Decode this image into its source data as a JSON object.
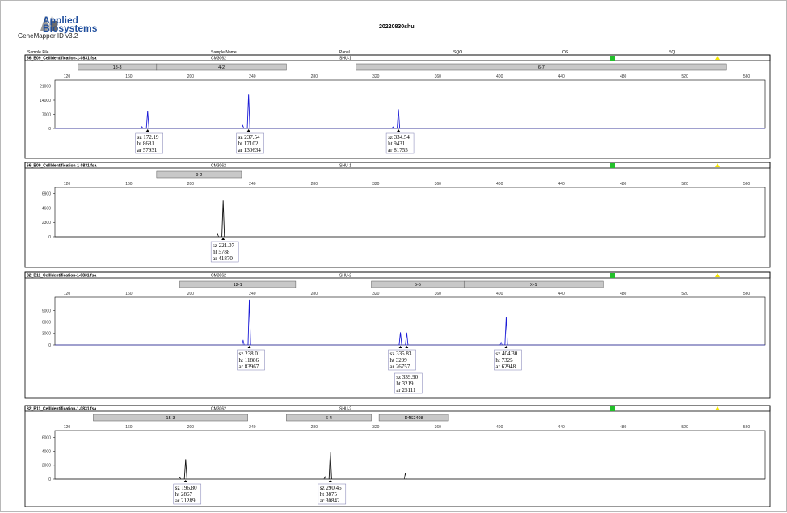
{
  "header": {
    "logo_line1": "Applied",
    "logo_line2": "Biosystems",
    "software": "GeneMapper ID v3.2",
    "title": "20220830shu"
  },
  "columns": {
    "sample_file": "Sample File",
    "sample_name": "Sample Name",
    "panel": "Panel",
    "sqo": "SQO",
    "os": "OS",
    "sq": "SQ"
  },
  "colors": {
    "blue": "#1a1ad6",
    "black": "#111111",
    "bin": "#c8c8c8",
    "green": "#22c02a",
    "yellow": "#f5e600"
  },
  "chart_data": [
    {
      "type": "line",
      "sample_file": "66_B09_CellIdentification-1-0831.fsa",
      "sample_name": "CM3062",
      "panel": "SHU-1",
      "color": "blue",
      "x_ticks": [
        120,
        160,
        200,
        240,
        280,
        320,
        360,
        400,
        440,
        480,
        520,
        560
      ],
      "y_ticks": [
        0,
        7000,
        14000,
        21000
      ],
      "xlim": [
        97,
        572
      ],
      "ylim": [
        0,
        24000
      ],
      "markers": [
        {
          "label": "18-3",
          "start": 127,
          "end": 178
        },
        {
          "label": "4-2",
          "start": 178,
          "end": 262
        },
        {
          "label": "6-7",
          "start": 307,
          "end": 547
        }
      ],
      "peaks": [
        {
          "x": 172.19,
          "height": 8681,
          "sz": "172.19",
          "ht": "8681",
          "ar": "57931"
        },
        {
          "x": 237.54,
          "height": 17102,
          "sz": "237.54",
          "ht": "17102",
          "ar": "130634"
        },
        {
          "x": 334.54,
          "height": 9431,
          "sz": "334.54",
          "ht": "9431",
          "ar": "81755"
        }
      ],
      "minor_peaks": [
        {
          "x": 168.5,
          "height": 900
        },
        {
          "x": 233.8,
          "height": 1500
        },
        {
          "x": 331,
          "height": 800
        }
      ]
    },
    {
      "type": "line",
      "sample_file": "66_B09_CellIdentification-1-0831.fsa",
      "sample_name": "CM3062",
      "panel": "SHU-1",
      "color": "black",
      "x_ticks": [
        120,
        160,
        200,
        240,
        280,
        320,
        360,
        400,
        440,
        480,
        520,
        560
      ],
      "y_ticks": [
        0,
        2300,
        4600,
        6900
      ],
      "xlim": [
        97,
        572
      ],
      "ylim": [
        0,
        7900
      ],
      "markers": [
        {
          "label": "9-2",
          "start": 178,
          "end": 233
        }
      ],
      "peaks": [
        {
          "x": 221.07,
          "height": 5788,
          "sz": "221.07",
          "ht": "5788",
          "ar": "41870"
        }
      ],
      "minor_peaks": [
        {
          "x": 217.5,
          "height": 400
        }
      ]
    },
    {
      "type": "line",
      "sample_file": "82_B11_CellIdentification-1-0831.fsa",
      "sample_name": "CM3062",
      "panel": "SHU-2",
      "color": "blue",
      "x_ticks": [
        120,
        160,
        200,
        240,
        280,
        320,
        360,
        400,
        440,
        480,
        520,
        560
      ],
      "y_ticks": [
        0,
        3000,
        6000,
        9000
      ],
      "xlim": [
        97,
        572
      ],
      "ylim": [
        0,
        12500
      ],
      "markers": [
        {
          "label": "12-1",
          "start": 193,
          "end": 268
        },
        {
          "label": "5-5",
          "start": 317,
          "end": 377
        },
        {
          "label": "X-1",
          "start": 377,
          "end": 467
        }
      ],
      "peaks": [
        {
          "x": 238.01,
          "height": 11886,
          "sz": "238.01",
          "ht": "11886",
          "ar": "83967"
        },
        {
          "x": 335.83,
          "height": 3299,
          "sz": "335.83",
          "ht": "3299",
          "ar": "26757"
        },
        {
          "x": 339.9,
          "height": 3219,
          "sz": "339.90",
          "ht": "3219",
          "ar": "25111"
        },
        {
          "x": 404.3,
          "height": 7325,
          "sz": "404.30",
          "ht": "7325",
          "ar": "62948"
        }
      ],
      "minor_peaks": [
        {
          "x": 234,
          "height": 1300
        },
        {
          "x": 401,
          "height": 700
        }
      ]
    },
    {
      "type": "line",
      "sample_file": "82_B11_CellIdentification-1-0831.fsa",
      "sample_name": "CM3062",
      "panel": "SHU-2",
      "color": "black",
      "x_ticks": [
        120,
        160,
        200,
        240,
        280,
        320,
        360,
        400,
        440,
        480,
        520,
        560
      ],
      "y_ticks": [
        0,
        2000,
        4000,
        6000
      ],
      "xlim": [
        97,
        572
      ],
      "ylim": [
        0,
        7000
      ],
      "markers": [
        {
          "label": "15-3",
          "start": 137,
          "end": 237
        },
        {
          "label": "6-4",
          "start": 262,
          "end": 317
        },
        {
          "label": "D4S2408",
          "start": 322,
          "end": 367
        }
      ],
      "peaks": [
        {
          "x": 196.8,
          "height": 2867,
          "sz": "196.80",
          "ht": "2867",
          "ar": "21289"
        },
        {
          "x": 290.45,
          "height": 3875,
          "sz": "290.45",
          "ht": "3875",
          "ar": "30842"
        }
      ],
      "minor_peaks": [
        {
          "x": 193,
          "height": 250
        },
        {
          "x": 287,
          "height": 350
        },
        {
          "x": 339,
          "height": 900
        }
      ]
    }
  ]
}
